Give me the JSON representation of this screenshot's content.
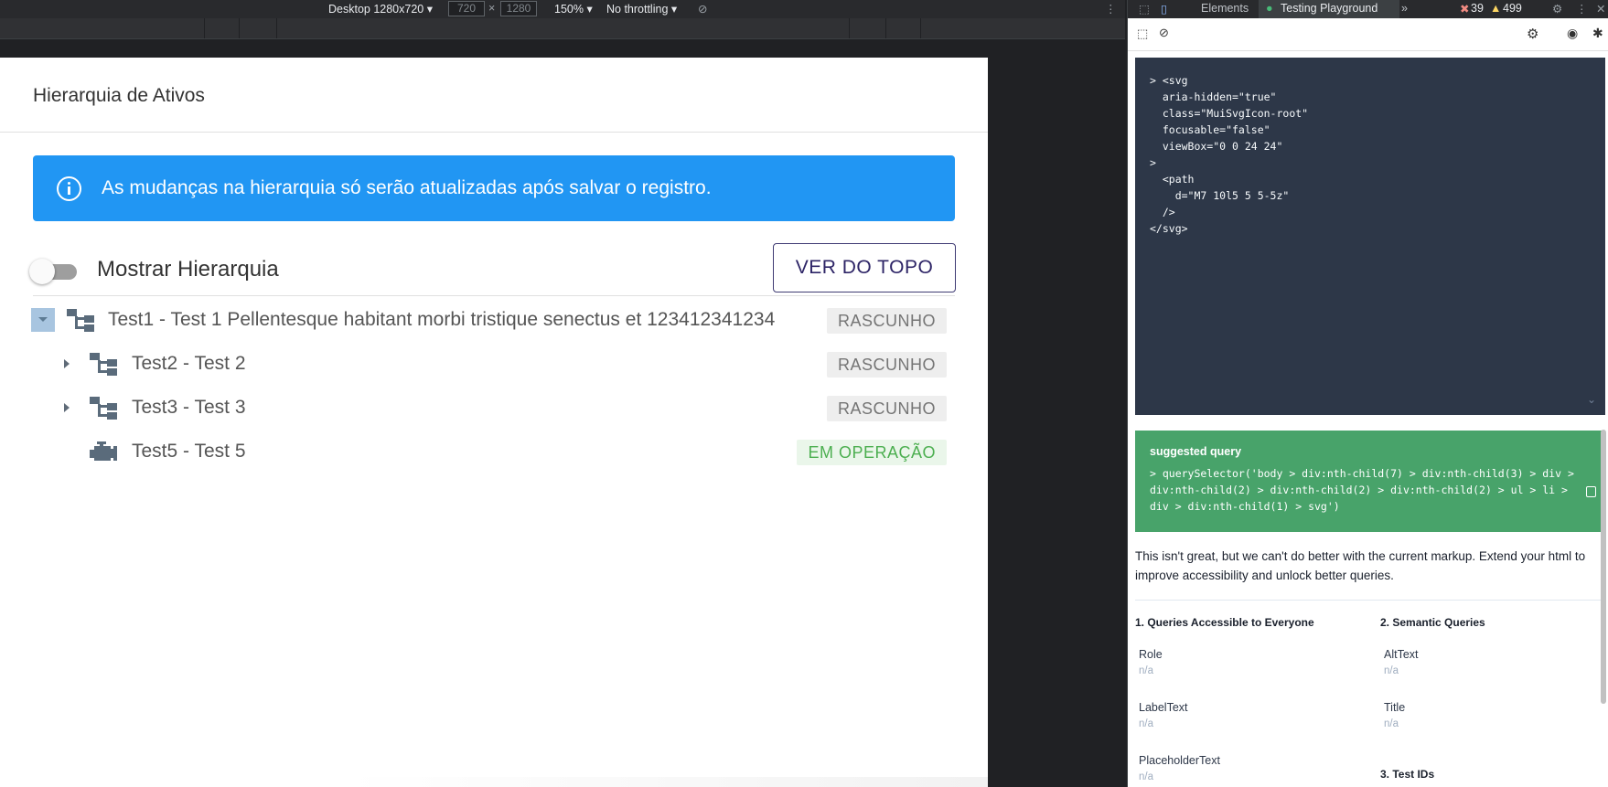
{
  "device_toolbar": {
    "device": "Desktop 1280x720",
    "width": "720",
    "height": "1280",
    "zoom": "150%",
    "throttling": "No throttling"
  },
  "page": {
    "title": "Hierarquia de Ativos",
    "alert": "As mudanças na hierarquia só serão atualizadas após salvar o registro.",
    "toggle_label": "Mostrar Hierarquia",
    "toggle_on": false,
    "top_button": "VER DO TOPO",
    "tree": [
      {
        "label": "Test1 - Test 1 Pellentesque habitant morbi tristique senectus et 123412341234",
        "status": "RASCUNHO",
        "expanded": true,
        "icon": "hierarchy-icon"
      },
      {
        "label": "Test2 - Test 2",
        "status": "RASCUNHO",
        "expanded": false,
        "icon": "hierarchy-icon"
      },
      {
        "label": "Test3 - Test 3",
        "status": "RASCUNHO",
        "expanded": false,
        "icon": "hierarchy-icon"
      },
      {
        "label": "Test5 - Test 5",
        "status": "EM OPERAÇÃO",
        "icon": "engine-icon"
      }
    ]
  },
  "devtools": {
    "tabs": [
      "Elements",
      "Testing Playground"
    ],
    "active_tab": "Testing Playground",
    "errors": "39",
    "warnings": "499",
    "code": "> <svg\n  aria-hidden=\"true\"\n  class=\"MuiSvgIcon-root\"\n  focusable=\"false\"\n  viewBox=\"0 0 24 24\"\n>\n  <path\n    d=\"M7 10l5 5 5-5z\"\n  />\n</svg>",
    "suggested_title": "suggested query",
    "suggested_query": "> querySelector('body > div:nth-child(7) > div:nth-child(3) > div > div:nth-child(2) > div:nth-child(2) > div:nth-child(2) > ul > li > div > div:nth-child(1) > svg')",
    "note": "This isn't great, but we can't do better with the current markup. Extend your html to improve accessibility and unlock better queries.",
    "sections": {
      "accessible": "1. Queries Accessible to Everyone",
      "semantic": "2. Semantic Queries",
      "testids": "3. Test IDs"
    },
    "queries": {
      "role": "Role",
      "labeltext": "LabelText",
      "placeholdertext": "PlaceholderText",
      "alttext": "AltText",
      "title": "Title",
      "na": "n/a"
    }
  },
  "colors": {
    "alert": "#2196f3",
    "button_border": "#3f3b73",
    "status_op": "#4caf50",
    "suggest": "#48a36a"
  }
}
